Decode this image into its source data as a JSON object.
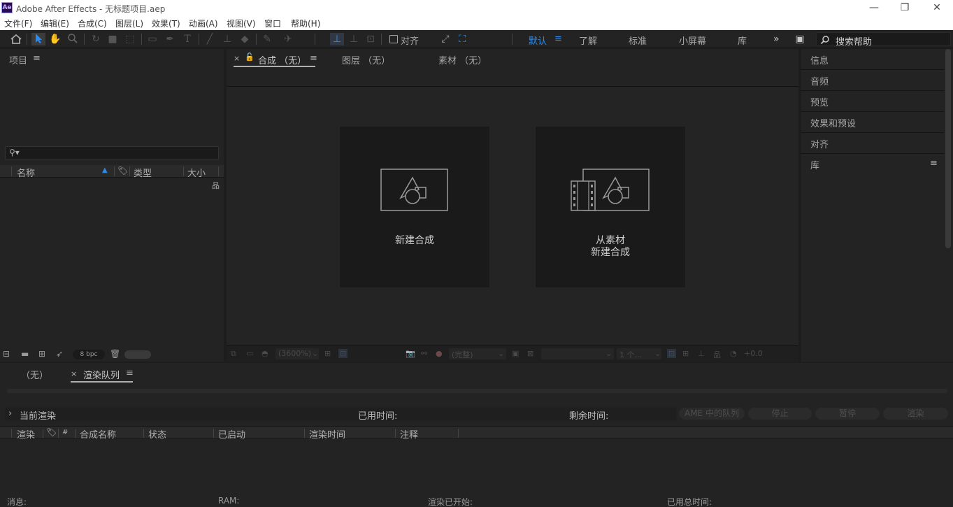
{
  "window": {
    "title": "Adobe After Effects - 无标题项目.aep",
    "logo": "Ae",
    "controls": [
      "minimize-icon",
      "restore-icon",
      "close-icon"
    ]
  },
  "menu": [
    "文件(F)",
    "编辑(E)",
    "合成(C)",
    "图层(L)",
    "效果(T)",
    "动画(A)",
    "视图(V)",
    "窗口",
    "帮助(H)"
  ],
  "toolbar": {
    "snap_label": "对齐",
    "workspaces": [
      "默认",
      "了解",
      "标准",
      "小屏幕",
      "库"
    ],
    "more": "»",
    "search_placeholder": "搜索帮助",
    "accent": "#2d8ceb"
  },
  "project": {
    "title": "项目",
    "columns": [
      "名称",
      "类型",
      "大小"
    ],
    "bpc": "8 bpc"
  },
  "viewer": {
    "tabs": [
      "合成 （无）",
      "图层 （无）",
      "素材 （无）"
    ],
    "new_comp": "新建合成",
    "from_footage_line1": "从素材",
    "from_footage_line2": "新建合成",
    "zoom": "(3600%)",
    "resolution": "(完整)",
    "views": "1 个...",
    "exposure": "+0.0"
  },
  "right_panels": [
    "信息",
    "音频",
    "预览",
    "效果和预设",
    "对齐",
    "库"
  ],
  "render": {
    "tab_none": "（无）",
    "tab_queue": "渲染队列",
    "current": "当前渲染",
    "elapsed": "已用时间:",
    "remaining": "剩余时间:",
    "buttons": [
      "AME 中的队列",
      "停止",
      "暂停",
      "渲染"
    ],
    "columns": [
      "渲染",
      "#",
      "合成名称",
      "状态",
      "已启动",
      "渲染时间",
      "注释"
    ],
    "bottom": [
      "消息:",
      "RAM:",
      "渲染已开始:",
      "已用总时间:"
    ]
  }
}
